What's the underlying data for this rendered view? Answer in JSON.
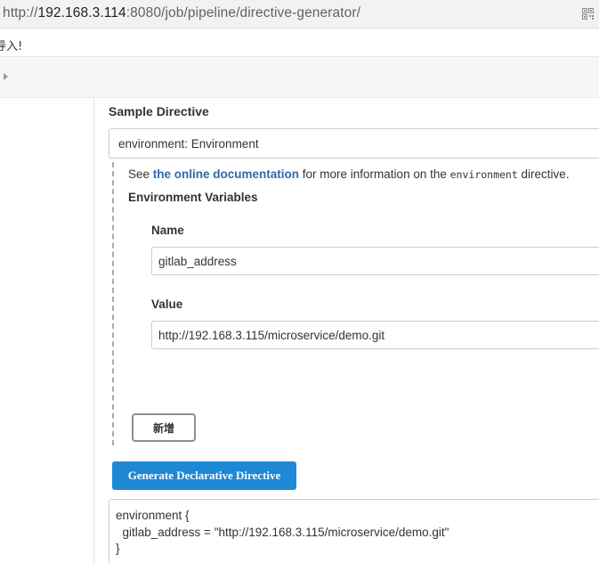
{
  "browser": {
    "url_prefix": "http://",
    "url_host": "192.168.3.114",
    "url_rest": ":8080/job/pipeline/directive-generator/",
    "qr_icon": "qr-code-icon"
  },
  "notice": {
    "text": "导入!"
  },
  "breadcrumb": {
    "caret_icon": "caret-right-icon"
  },
  "sample": {
    "title": "Sample Directive",
    "selected": "environment: Environment"
  },
  "help": {
    "prefix": "See ",
    "link": "the online documentation",
    "middle": " for more information on the ",
    "code": "environment",
    "suffix": " directive."
  },
  "env": {
    "title": "Environment Variables",
    "name_label": "Name",
    "name_value": "gitlab_address",
    "value_label": "Value",
    "value_value": "http://192.168.3.115/microservice/demo.git",
    "add_label": "新增"
  },
  "generate": {
    "label": "Generate Declarative Directive"
  },
  "output": {
    "text": "environment {\n  gitlab_address = \"http://192.168.3.115/microservice/demo.git\"\n}"
  },
  "colors": {
    "link": "#2e6ba8",
    "primary_button": "#1f88d6",
    "url_bar": "#f2f2f2"
  }
}
